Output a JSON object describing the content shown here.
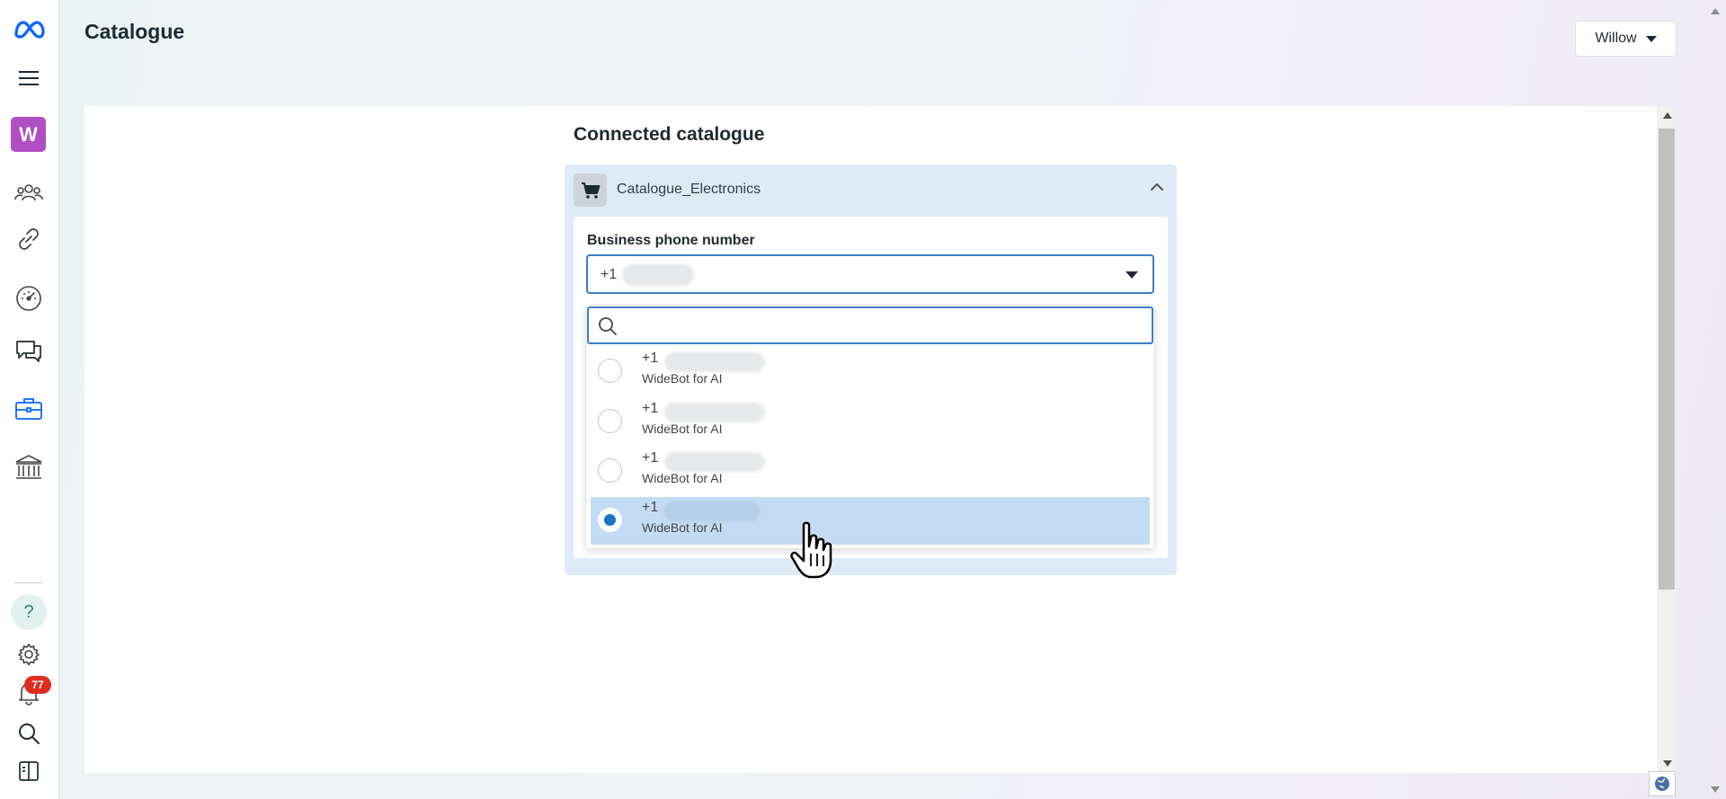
{
  "header": {
    "title": "Catalogue",
    "account_name": "Willow"
  },
  "sidebar": {
    "account_initial": "W",
    "help_label": "?",
    "notification_count": "77",
    "items": [
      {
        "icon": "meta-logo-icon"
      },
      {
        "icon": "menu-icon"
      },
      {
        "icon": "people-icon"
      },
      {
        "icon": "link-icon"
      },
      {
        "icon": "speedometer-icon"
      },
      {
        "icon": "chat-icon"
      },
      {
        "icon": "briefcase-icon"
      },
      {
        "icon": "bank-icon"
      },
      {
        "icon": "settings-icon"
      },
      {
        "icon": "bell-icon"
      },
      {
        "icon": "search-icon"
      },
      {
        "icon": "panel-toggle-icon"
      }
    ]
  },
  "main": {
    "section_title": "Connected catalogue",
    "catalogue_name": "Catalogue_Electronics",
    "phone_field": {
      "label": "Business phone number",
      "selected_prefix": "+1"
    },
    "dropdown": {
      "search_placeholder": "",
      "options": [
        {
          "number_prefix": "+1",
          "business": "WideBot for AI",
          "selected": false
        },
        {
          "number_prefix": "+1",
          "business": "WideBot for AI",
          "selected": false
        },
        {
          "number_prefix": "+1",
          "business": "WideBot for AI",
          "selected": false
        },
        {
          "number_prefix": "+1",
          "business": "WideBot for AI",
          "selected": true
        }
      ]
    }
  },
  "colors": {
    "accent": "#3b7fc4",
    "selected_row": "#c4dcf3",
    "badge": "#e02b20",
    "avatar": "#b04fc4"
  }
}
